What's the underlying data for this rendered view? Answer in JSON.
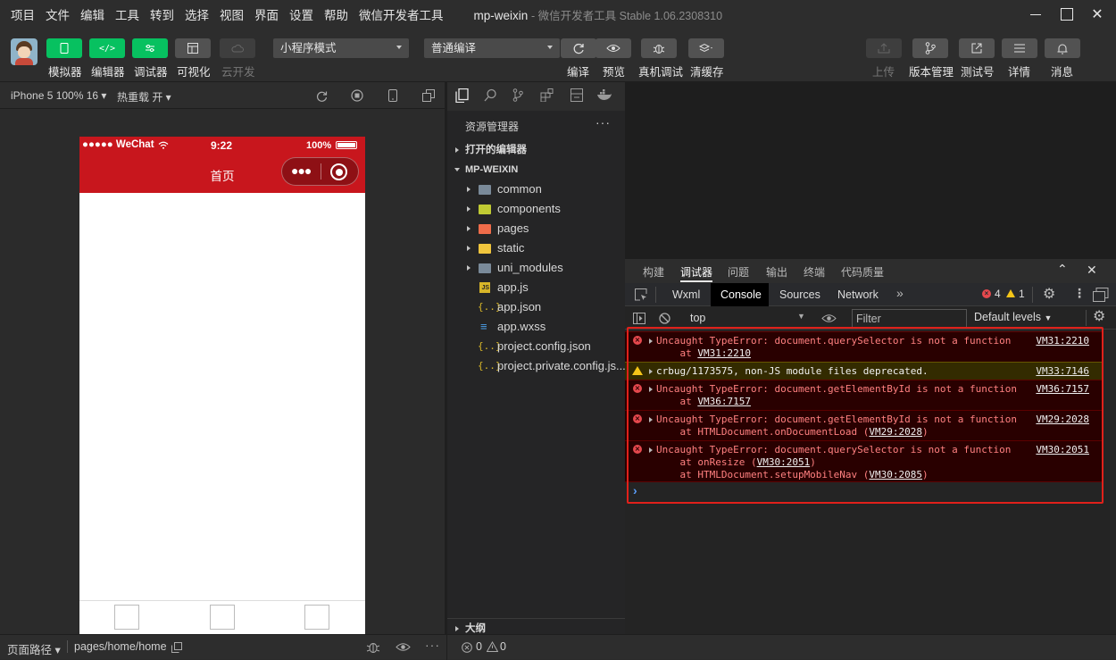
{
  "menu": [
    "项目",
    "文件",
    "编辑",
    "工具",
    "转到",
    "选择",
    "视图",
    "界面",
    "设置",
    "帮助",
    "微信开发者工具"
  ],
  "window": {
    "title": "mp-weixin",
    "subtitle": "- 微信开发者工具 Stable 1.06.2308310"
  },
  "toolbar": {
    "simulator": "模拟器",
    "editor": "编辑器",
    "debugger": "调试器",
    "visual": "可视化",
    "cloud": "云开发",
    "mode_select": "小程序模式",
    "compile_select": "普通编译",
    "compile": "编译",
    "preview": "预览",
    "remote_debug": "真机调试",
    "clear_cache": "清缓存",
    "upload": "上传",
    "version": "版本管理",
    "test_account": "测试号",
    "details": "详情",
    "messages": "消息"
  },
  "simulator": {
    "device": "iPhone 5 100% 16",
    "hot_reload": "热重载 开",
    "carrier": "●●●●● WeChat",
    "time": "9:22",
    "battery": "100%",
    "page_title": "首页"
  },
  "explorer": {
    "title": "资源管理器",
    "open_editors": "打开的编辑器",
    "project": "MP-WEIXIN",
    "folders": [
      "common",
      "components",
      "pages",
      "static",
      "uni_modules"
    ],
    "files": [
      "app.js",
      "app.json",
      "app.wxss",
      "project.config.json",
      "project.private.config.js..."
    ],
    "outline": "大纲"
  },
  "devtools": {
    "tabs": [
      "构建",
      "调试器",
      "问题",
      "输出",
      "终端",
      "代码质量"
    ],
    "subtabs": [
      "Wxml",
      "Console",
      "Sources",
      "Network"
    ],
    "err_count": "4",
    "warn_count": "1",
    "context": "top",
    "filter_placeholder": "Filter",
    "levels": "Default levels"
  },
  "console": {
    "messages": [
      {
        "type": "error",
        "lines": [
          "Uncaught TypeError: document.querySelector is not a function",
          "    at VM31:2210"
        ],
        "source": "VM31:2210"
      },
      {
        "type": "warning",
        "lines": [
          "crbug/1173575, non-JS module files deprecated."
        ],
        "source": "VM33:7146"
      },
      {
        "type": "error",
        "lines": [
          "Uncaught TypeError: document.getElementById is not a function",
          "    at VM36:7157"
        ],
        "source": "VM36:7157"
      },
      {
        "type": "error",
        "lines": [
          "Uncaught TypeError: document.getElementById is not a function",
          "    at HTMLDocument.onDocumentLoad (VM29:2028)"
        ],
        "source": "VM29:2028"
      },
      {
        "type": "error",
        "lines": [
          "Uncaught TypeError: document.querySelector is not a function",
          "    at onResize (VM30:2051)",
          "    at HTMLDocument.setupMobileNav (VM30:2085)"
        ],
        "source": "VM30:2051"
      }
    ],
    "prompt": "›"
  },
  "status": {
    "page_path_label": "页面路径",
    "page_path": "pages/home/home",
    "errors": "0",
    "warnings": "0"
  }
}
